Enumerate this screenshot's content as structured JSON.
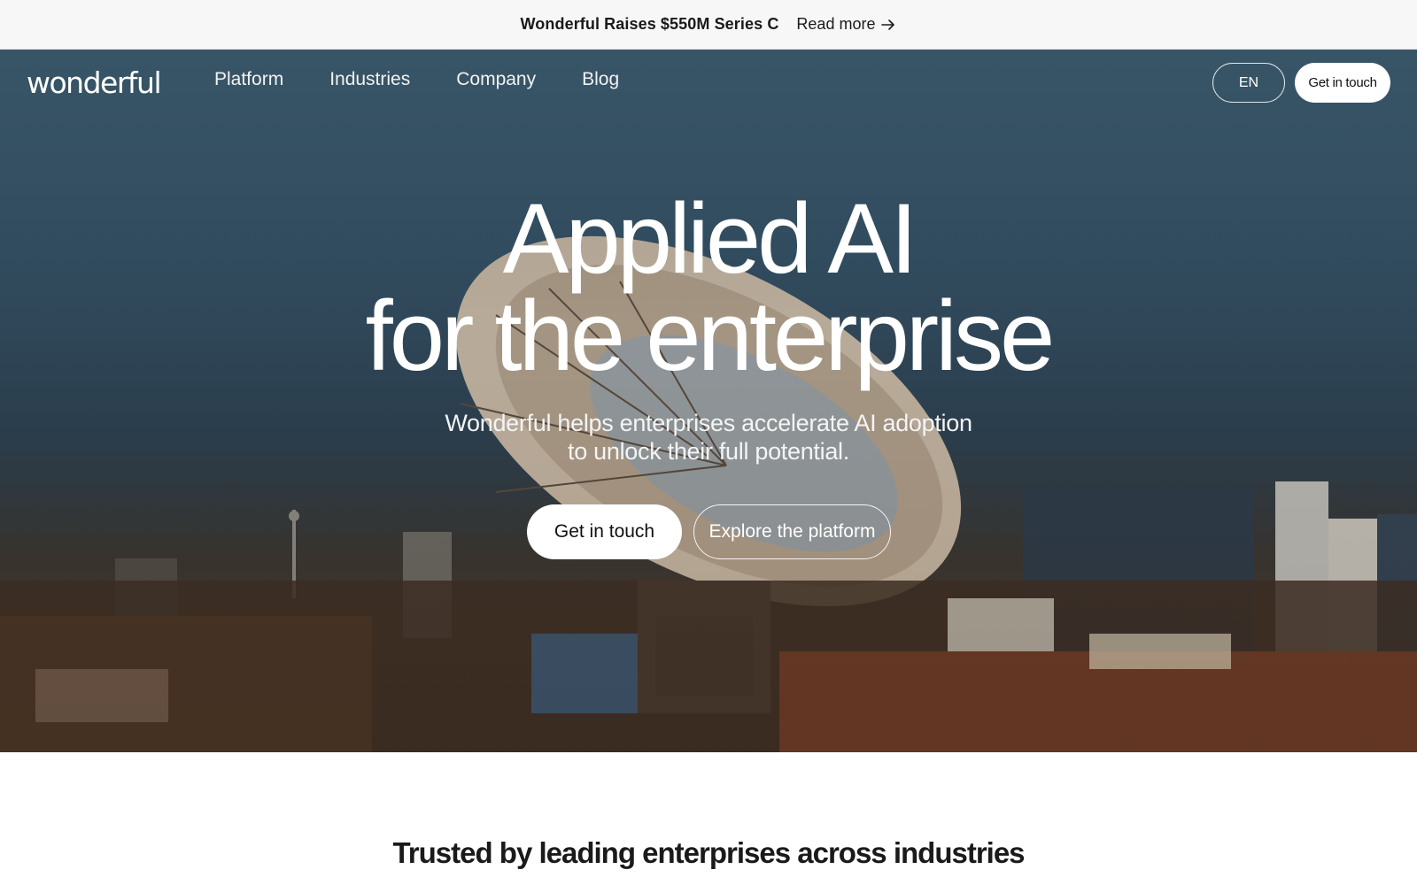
{
  "announcement": {
    "headline": "Wonderful Raises $550M Series C",
    "link_label": "Read more"
  },
  "nav": {
    "logo": "wonderful",
    "links": [
      "Platform",
      "Industries",
      "Company",
      "Blog"
    ],
    "language": "EN",
    "cta_label": "Get in touch"
  },
  "hero": {
    "title_line1": "Applied AI",
    "title_line2": "for the enterprise",
    "subtitle": "Wonderful helps enterprises accelerate AI adoption to unlock their full potential.",
    "primary_button": "Get in touch",
    "secondary_button": "Explore the platform"
  },
  "trusted": {
    "heading": "Trusted by leading enterprises across industries"
  },
  "icons": {
    "read_more": "arrow-right-icon"
  },
  "colors": {
    "announcement_bg": "#f7f7f7",
    "button_bg": "#ffffff",
    "hero_sky": "#3e5f72"
  }
}
